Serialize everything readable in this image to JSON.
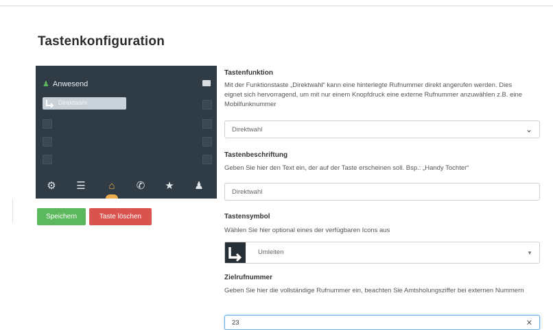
{
  "page": {
    "title": "Tastenkonfiguration"
  },
  "preview": {
    "presence_label": "Anwesend",
    "key_label": "Direktwahl",
    "nav_icons": [
      "gear-icon",
      "list-icon",
      "home-icon",
      "phone-icon",
      "star-icon",
      "user-icon"
    ],
    "nav_glyphs": [
      "⚙",
      "☰",
      "⌂",
      "✆",
      "★",
      "♟"
    ],
    "active_nav": "home-icon"
  },
  "buttons": {
    "save": "Speichern",
    "delete": "Taste löschen"
  },
  "form": {
    "function": {
      "label": "Tastenfunktion",
      "help": "Mit der Funktionstaste „Direktwahl“ kann eine hinterlegte Rufnummer direkt angerufen werden. Dies eignet sich hervorragend, um mit nur einem Knopfdruck eine externe Rufnummer anzuwählen z.B. eine Mobilfunknummer",
      "value": "Direktwahl"
    },
    "caption": {
      "label": "Tastenbeschriftung",
      "help": "Geben Sie hier den Text ein, der auf der Taste erscheinen soll. Bsp.: „Handy Tochter“",
      "value": "Direktwahl"
    },
    "symbol": {
      "label": "Tastensymbol",
      "help": "Wählen Sie hier optional eines der verfügbaren Icons aus",
      "value": "Umleiten"
    },
    "target": {
      "label": "Zielrufnummer",
      "help": "Geben Sie hier die vollständige Rufnummer ein, beachten Sie Amtsholungsziffer bei externen Nummern",
      "value": "23"
    }
  },
  "colors": {
    "panel": "#2f3b45",
    "accent": "#f0ad4e",
    "save": "#5cb85c",
    "delete": "#d9534f"
  }
}
